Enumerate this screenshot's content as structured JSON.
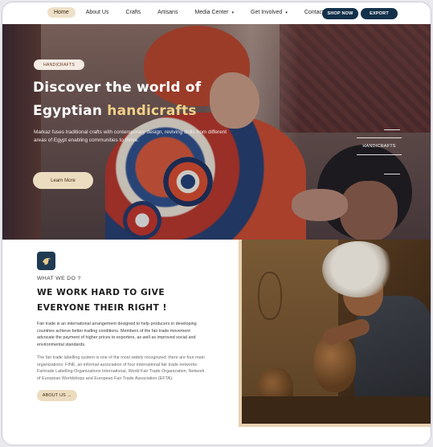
{
  "nav": {
    "links": [
      {
        "label": "Home",
        "active": true
      },
      {
        "label": "About Us"
      },
      {
        "label": "Crafts"
      },
      {
        "label": "Artisans"
      },
      {
        "label": "Media Center",
        "dropdown": true
      },
      {
        "label": "Get Involved",
        "dropdown": true
      },
      {
        "label": "Contact Us"
      }
    ],
    "shop_label": "SHOP NOW",
    "export_label": "EXPORT",
    "dropdown_caret": "▾"
  },
  "hero": {
    "pill": "HANDICRAFTS",
    "title_line1": "Discover the world of",
    "title_line2_plain": "Egyptian",
    "title_line2_accent": "handicrafts",
    "description": "Markaz fuses traditional crafts with contemporary design, reviving skills from different areas of Egypt enabling communities to thrive.",
    "cta": "Learn More",
    "side_label": "HANDICRAFTS"
  },
  "about": {
    "icon": "bird-logo-icon",
    "eyebrow": "WHAT WE DO ?",
    "heading_line1": "WE WORK HARD TO GIVE",
    "heading_line2": "EVERYONE THEIR RIGHT !",
    "paragraph1": "Fair trade is an international arrangement designed to help producers in developing countries achieve better trading conditions. Members of the fair trade movement advocate the payment of higher prices to exporters, as well as improved social and environmental standards.",
    "paragraph2": "The fair trade labelling system is one of the most widely recognized; there are four main organizations: FINE, an informal association of four international fair trade networks: Fairtrade Labelling Organizations International, World Fair Trade Organization, Network of European Worldshops and European Fair Trade Association (EFTA).",
    "cta": "ABOUT US →"
  },
  "colors": {
    "nav_active_bg": "#eee0c8",
    "button_dark": "#13314a",
    "hero_accent": "#f1d089",
    "cream_button": "#ecdcc0"
  }
}
